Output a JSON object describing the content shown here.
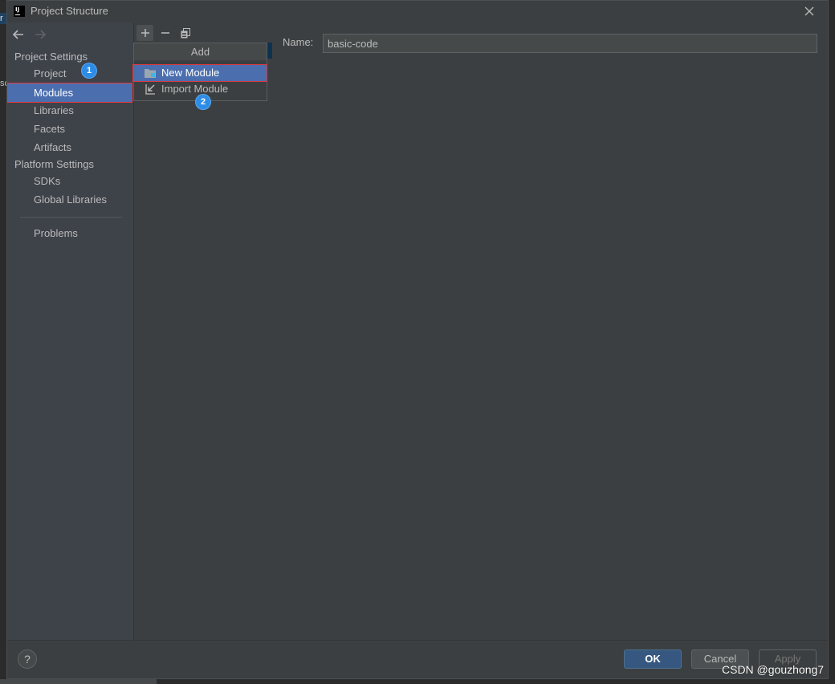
{
  "window": {
    "title": "Project Structure",
    "logo_text": "IJ"
  },
  "background_window": {
    "fragment_top": "r",
    "fragment_left": "sc"
  },
  "navigation": {
    "back_icon": "arrow-left-icon",
    "forward_icon": "arrow-right-icon",
    "forward_enabled": false
  },
  "sidebar": {
    "sections": [
      {
        "header": "Project Settings",
        "items": [
          {
            "label": "Project",
            "selected": false
          },
          {
            "label": "Modules",
            "selected": true
          },
          {
            "label": "Libraries",
            "selected": false
          },
          {
            "label": "Facets",
            "selected": false
          },
          {
            "label": "Artifacts",
            "selected": false
          }
        ]
      },
      {
        "header": "Platform Settings",
        "items": [
          {
            "label": "SDKs",
            "selected": false
          },
          {
            "label": "Global Libraries",
            "selected": false
          }
        ]
      }
    ],
    "problems": {
      "label": "Problems"
    }
  },
  "toolbar": {
    "add_icon": "plus-icon",
    "remove_icon": "minus-icon",
    "copy_icon": "copy-icon"
  },
  "add_popup": {
    "title": "Add",
    "items": [
      {
        "label": "New Module",
        "icon": "new-module-icon",
        "highlighted": true
      },
      {
        "label": "Import Module",
        "icon": "import-module-icon",
        "highlighted": false
      }
    ]
  },
  "details": {
    "name_label": "Name:",
    "name_value": "basic-code"
  },
  "footer": {
    "help_label": "?",
    "ok_label": "OK",
    "cancel_label": "Cancel",
    "apply_label": "Apply",
    "apply_enabled": false
  },
  "step_badges": [
    "1",
    "2"
  ],
  "watermark": "CSDN @gouzhong7",
  "colors": {
    "dialog_background": "#3c3f41",
    "sidebar_background": "#3e4249",
    "selection": "#4b6eaf",
    "annotation_border": "#e0393e",
    "step_badge": "#2d8ce6",
    "ok_button": "#365880",
    "text": "#bbbbbb"
  }
}
